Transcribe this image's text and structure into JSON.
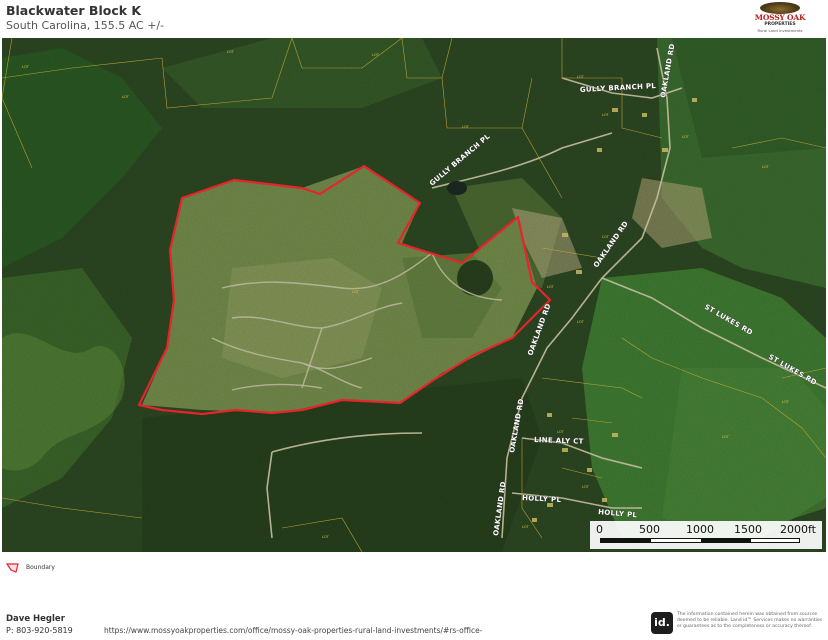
{
  "header": {
    "title": "Blackwater Block K",
    "subtitle": "South Carolina, 155.5 AC +/-"
  },
  "logo": {
    "name": "MOSSY OAK",
    "line1": "PROPERTIES",
    "line2": "Rural Land Investments"
  },
  "map": {
    "boundary_color": "#e8232b",
    "road_labels": [
      {
        "text": "GULLY BRANCH PL"
      },
      {
        "text": "GULLY BRANCH PL"
      },
      {
        "text": "OAKLAND RD"
      },
      {
        "text": "OAKLAND RD"
      },
      {
        "text": "OAKLAND RD"
      },
      {
        "text": "OAKLAND RD"
      },
      {
        "text": "OAKLAND RD"
      },
      {
        "text": "ST LUKES RD"
      },
      {
        "text": "ST LUKES RD"
      },
      {
        "text": "LINE ALY CT"
      },
      {
        "text": "HOLLY PL"
      },
      {
        "text": "HOLLY PL"
      }
    ]
  },
  "scalebar": {
    "ticks": [
      "0",
      "500",
      "1000",
      "1500",
      "2000ft"
    ]
  },
  "legend": {
    "items": [
      {
        "label": "Boundary",
        "color": "#e8232b"
      }
    ]
  },
  "footer": {
    "agent_name": "Dave Hegler",
    "agent_phone": "P: 803-920-5819",
    "agent_url": "https://www.mossyoakproperties.com/office/mossy-oak-properties-rural-land-investments/#rs-office-",
    "id_logo": "id.",
    "disclaimer": "The information contained herein was obtained from sources deemed to be reliable. Land id™ Services makes no warranties or guarantees as to the completeness or accuracy thereof."
  }
}
